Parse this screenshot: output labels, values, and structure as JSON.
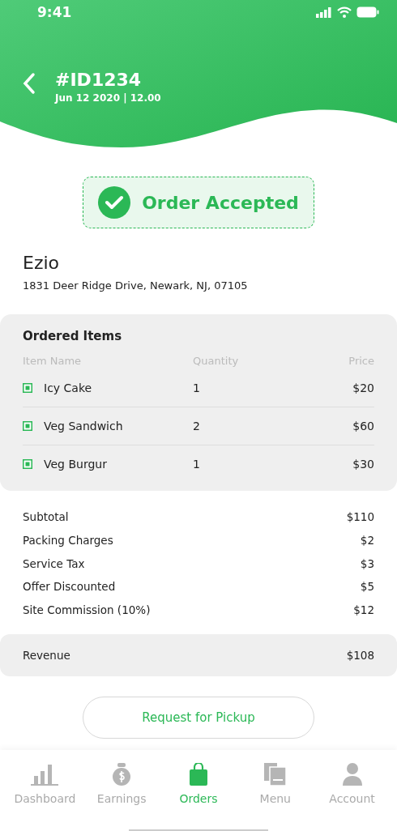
{
  "status_bar": {
    "time": "9:41"
  },
  "header": {
    "title": "#ID1234",
    "subtitle": "Jun 12 2020 | 12.00"
  },
  "status_badge": {
    "label": "Order Accepted"
  },
  "customer": {
    "name": "Ezio",
    "address": "1831  Deer Ridge Drive, Newark, NJ, 07105"
  },
  "ordered_items": {
    "title": "Ordered Items",
    "columns": [
      "Item Name",
      "Quantity",
      "Price"
    ],
    "rows": [
      {
        "name": "Icy Cake",
        "quantity": "1",
        "price": "$20"
      },
      {
        "name": "Veg Sandwich",
        "quantity": "2",
        "price": "$60"
      },
      {
        "name": "Veg Burgur",
        "quantity": "1",
        "price": "$30"
      }
    ]
  },
  "charges": [
    {
      "label": "Subtotal",
      "value": "$110"
    },
    {
      "label": "Packing Charges",
      "value": "$2"
    },
    {
      "label": "Service Tax",
      "value": "$3"
    },
    {
      "label": "Offer Discounted",
      "value": "$5"
    },
    {
      "label": "Site Commission (10%)",
      "value": "$12"
    }
  ],
  "revenue": {
    "label": "Revenue",
    "value": "$108"
  },
  "action_button": "Request for Pickup",
  "tab_bar": [
    {
      "label": "Dashboard",
      "kind": "chart",
      "selected": false
    },
    {
      "label": "Earnings",
      "kind": "money",
      "selected": false
    },
    {
      "label": "Orders",
      "kind": "bag",
      "selected": true
    },
    {
      "label": "Menu",
      "kind": "menu",
      "selected": false
    },
    {
      "label": "Account",
      "kind": "user",
      "selected": false
    }
  ]
}
